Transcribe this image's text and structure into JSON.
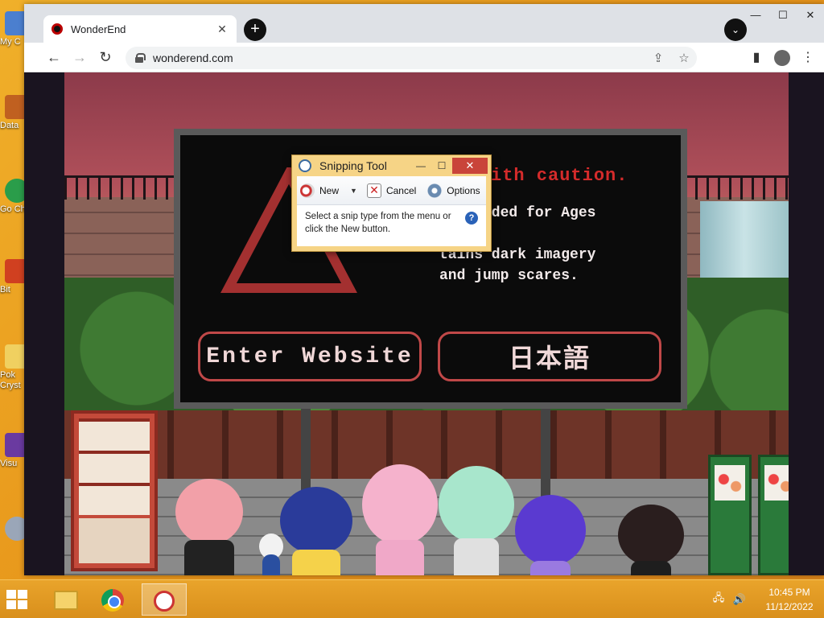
{
  "desktop": {
    "icons": [
      {
        "label": "My C",
        "color": "#4b7fcf"
      },
      {
        "label": "Data",
        "color": "#c06020"
      },
      {
        "label": "Go Ch",
        "color": "#2a9d4a"
      },
      {
        "label": "Bit",
        "color": "#d04020"
      },
      {
        "label": "Pok Cryst",
        "color": "#f0d060"
      },
      {
        "label": "Visu",
        "color": "#6a3aa0"
      }
    ]
  },
  "browser": {
    "tab": {
      "title": "WonderEnd",
      "close": "✕"
    },
    "new_tab": "+",
    "tab_search": "⌄",
    "window_controls": {
      "minimize": "—",
      "maximize": "☐",
      "close": "✕"
    },
    "nav": {
      "back": "←",
      "forward": "→",
      "reload": "↻"
    },
    "address": {
      "url": "wonderend.com"
    },
    "omnibox_icons": {
      "share": "⇪",
      "bookmark": "☆"
    },
    "toolbar_icons": {
      "side_panel": "▮",
      "menu": "⋮"
    }
  },
  "page": {
    "caution_text": "ith caution.",
    "info_text": "commended for Ages\n14+\ntains dark imagery\nand jump scares.",
    "enter_button": "Enter Website",
    "japanese_button": "日本語"
  },
  "snipping_tool": {
    "title": "Snipping Tool",
    "controls": {
      "minimize": "—",
      "maximize": "☐",
      "close": "✕"
    },
    "new_label": "New",
    "cancel_label": "Cancel",
    "options_label": "Options",
    "message": "Select a snip type from the menu or click the New button.",
    "help": "?"
  },
  "taskbar": {
    "tray_icons": {
      "network": "🖧",
      "volume": "🔊"
    },
    "time": "10:45 PM",
    "date": "11/12/2022"
  }
}
